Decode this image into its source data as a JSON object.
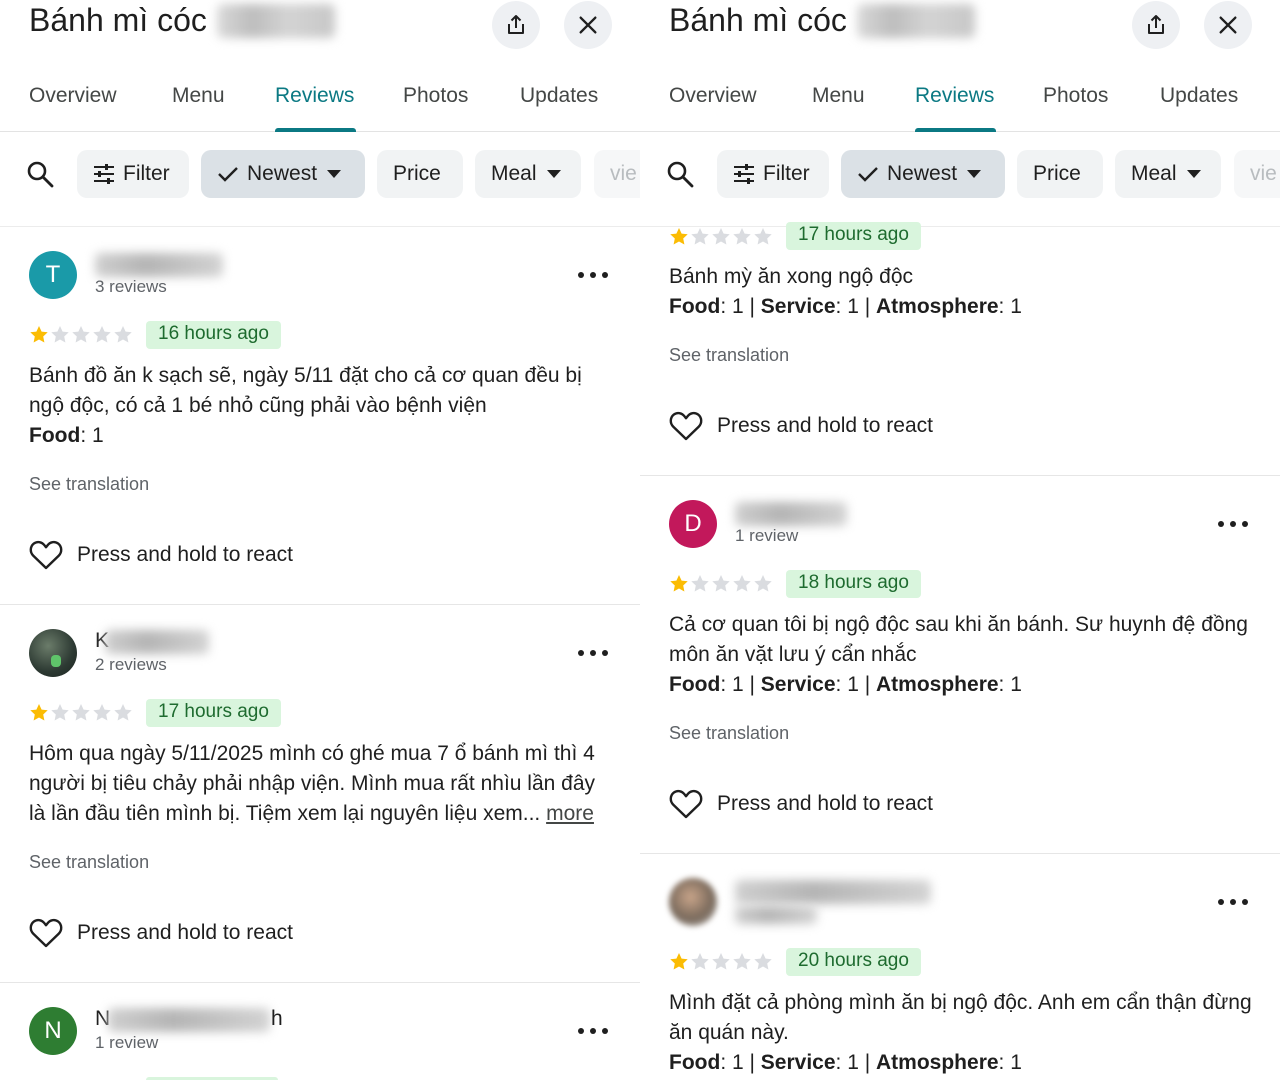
{
  "left": {
    "header": {
      "title": "Bánh mì cóc",
      "share_icon": "share-icon",
      "close_icon": "close-icon"
    },
    "tabs": [
      {
        "label": "Overview",
        "active": false
      },
      {
        "label": "Menu",
        "active": false
      },
      {
        "label": "Reviews",
        "active": true
      },
      {
        "label": "Photos",
        "active": false
      },
      {
        "label": "Updates",
        "active": false
      }
    ],
    "chips": {
      "search_icon": "search-icon",
      "filter": "Filter",
      "newest": "Newest",
      "price": "Price",
      "meal": "Meal",
      "cut_off": "vie"
    },
    "reviews": [
      {
        "avatar_letter": "T",
        "avatar_color": "#1a9aa8",
        "meta": "3 reviews",
        "rating": 1,
        "time": "16 hours ago",
        "text": "Bánh đồ ăn k sạch sẽ, ngày 5/11 đặt cho cả cơ quan đều bị ngộ độc, có cả 1 bé nhỏ cũng phải vào bệnh viện",
        "ratings_label_food": "Food",
        "ratings_value_food": ": 1",
        "see_translation": "See translation",
        "react": "Press and hold to react"
      },
      {
        "name_visible_char": "K",
        "meta": "2 reviews",
        "rating": 1,
        "time": "17 hours ago",
        "text": "Hôm qua ngày 5/11/2025 mình có ghé mua 7 ổ bánh mì thì 4 người bị tiêu chảy phải nhập viện. Mình mua rất nhìu lần đây là lần đầu tiên mình bị. Tiệm xem lại nguyên liệu xem...",
        "more": "more",
        "see_translation": "See translation",
        "react": "Press and hold to react"
      },
      {
        "avatar_letter": "N",
        "avatar_color": "#2e7d32",
        "name_visible_first": "N",
        "name_visible_last": "h",
        "meta": "1 review"
      }
    ]
  },
  "right": {
    "header": {
      "title": "Bánh mì cóc",
      "share_icon": "share-icon",
      "close_icon": "close-icon"
    },
    "tabs": [
      {
        "label": "Overview",
        "active": false
      },
      {
        "label": "Menu",
        "active": false
      },
      {
        "label": "Reviews",
        "active": true
      },
      {
        "label": "Photos",
        "active": false
      },
      {
        "label": "Updates",
        "active": false
      }
    ],
    "chips": {
      "search_icon": "search-icon",
      "filter": "Filter",
      "newest": "Newest",
      "price": "Price",
      "meal": "Meal",
      "cut_off": "vie"
    },
    "reviews": [
      {
        "rating": 1,
        "time": "17 hours ago",
        "text": "Bánh mỳ ăn xong ngộ độc",
        "food_label": "Food",
        "food_value": ": 1 | ",
        "service_label": "Service",
        "service_value": ": 1 | ",
        "atmosphere_label": "Atmosphere",
        "atmosphere_value": ": 1",
        "see_translation": "See translation",
        "react": "Press and hold to react"
      },
      {
        "avatar_letter": "D",
        "avatar_color": "#c2185b",
        "meta": "1 review",
        "rating": 1,
        "time": "18 hours ago",
        "text": "Cả cơ quan tôi bị ngộ độc sau khi ăn bánh. Sư huynh đệ đồng môn ăn vặt lưu ý cẩn nhắc",
        "food_label": "Food",
        "food_value": ": 1 | ",
        "service_label": "Service",
        "service_value": ": 1 | ",
        "atmosphere_label": "Atmosphere",
        "atmosphere_value": ": 1",
        "see_translation": "See translation",
        "react": "Press and hold to react"
      },
      {
        "rating": 1,
        "time": "20 hours ago",
        "text": "Mình đặt cả phòng mình ăn bị ngộ độc. Anh em cẩn thận đừng ăn quán này.",
        "food_label": "Food",
        "food_value": ": 1 | ",
        "service_label": "Service",
        "service_value": ": 1 | ",
        "atmosphere_label": "Atmosphere",
        "atmosphere_value": ": 1"
      }
    ]
  },
  "colors": {
    "accent": "#0b7983",
    "star_filled": "#fbbc04",
    "star_empty": "#dadce0",
    "badge_bg": "#d9f5dd",
    "badge_text": "#1e6b2f"
  }
}
